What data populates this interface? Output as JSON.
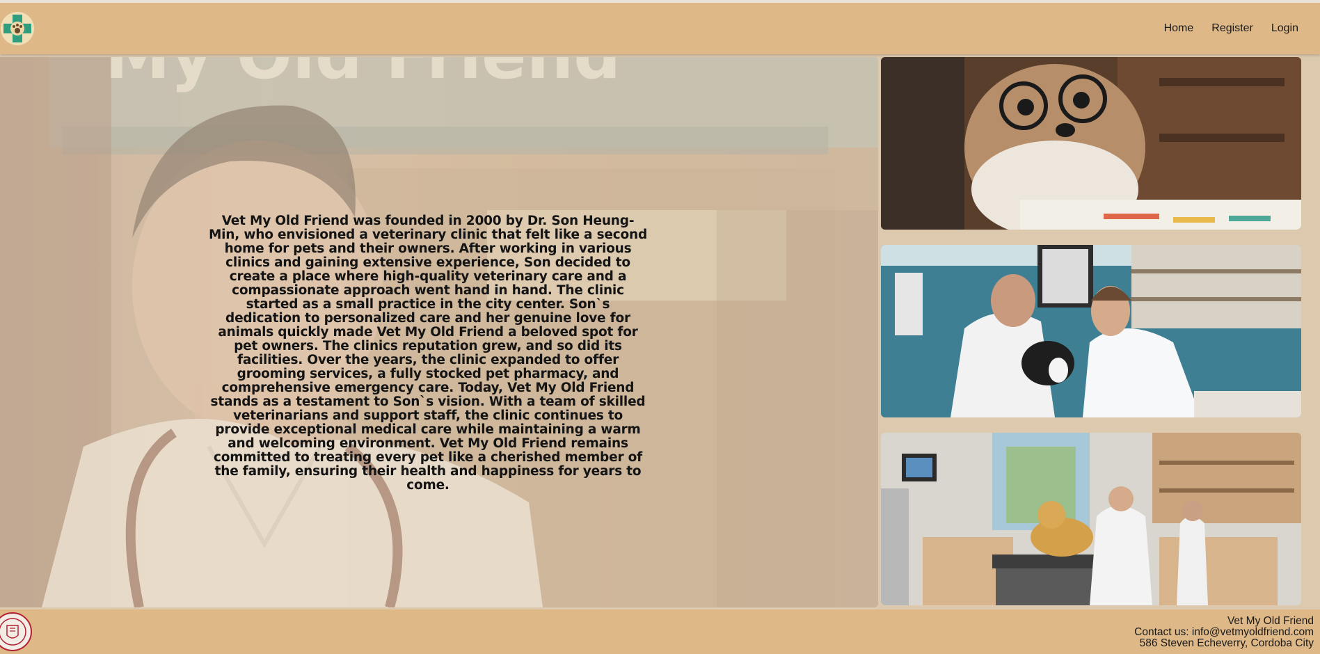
{
  "header": {
    "logo_icon": "paw-cross-logo-icon",
    "nav": [
      {
        "label": "Home"
      },
      {
        "label": "Register"
      },
      {
        "label": "Login"
      }
    ]
  },
  "hero": {
    "background_sign_text": "My Old Friend",
    "story": "Vet My Old Friend was founded in 2000 by Dr. Son Heung-Min, who envisioned a veterinary clinic that felt like a second home for pets and their owners. After working in various clinics and gaining extensive experience, Son decided to create a place where high-quality veterinary care and a compassionate approach went hand in hand. The clinic started as a small practice in the city center. Son`s dedication to personalized care and her genuine love for animals quickly made Vet My Old Friend a beloved spot for pet owners. The clinics reputation grew, and so did its facilities. Over the years, the clinic expanded to offer grooming services, a fully stocked pet pharmacy, and comprehensive emergency care. Today, Vet My Old Friend stands as a testament to Son`s vision. With a team of skilled veterinarians and support staff, the clinic continues to provide exceptional medical care while maintaining a warm and welcoming environment. Vet My Old Friend remains committed to treating every pet like a cherished member of the family, ensuring their health and happiness for years to come."
  },
  "photos": [
    {
      "subject": "dog-with-glasses-photo"
    },
    {
      "subject": "vets-examining-cat-photo"
    },
    {
      "subject": "vets-examining-dog-photo"
    }
  ],
  "footer": {
    "seal_icon": "university-seal-icon",
    "name": "Vet My Old Friend",
    "contact": "Contact us: info@vetmyoldfriend.com",
    "address": "586 Steven Echeverry, Cordoba City"
  },
  "colors": {
    "header_bg": "#deb887",
    "page_bg": "#dcc9ae",
    "text": "#141414"
  }
}
